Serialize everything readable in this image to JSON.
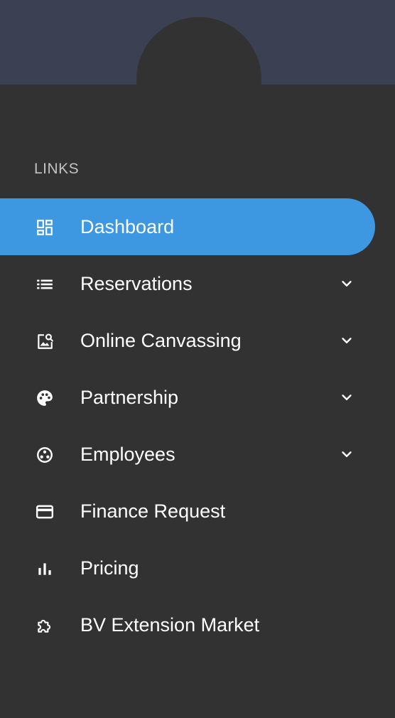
{
  "colors": {
    "header": "#3b4152",
    "background": "#323232",
    "active": "#3d98e1",
    "text": "#ffffff",
    "muted": "#c2c2c2"
  },
  "section": {
    "label": "LINKS"
  },
  "menu": {
    "items": [
      {
        "label": "Dashboard",
        "icon": "dashboard-icon",
        "active": true,
        "expandable": false
      },
      {
        "label": "Reservations",
        "icon": "list-icon",
        "active": false,
        "expandable": true
      },
      {
        "label": "Online Canvassing",
        "icon": "image-search-icon",
        "active": false,
        "expandable": true
      },
      {
        "label": "Partnership",
        "icon": "palette-icon",
        "active": false,
        "expandable": true
      },
      {
        "label": "Employees",
        "icon": "group-circle-icon",
        "active": false,
        "expandable": true
      },
      {
        "label": "Finance Request",
        "icon": "credit-card-icon",
        "active": false,
        "expandable": false
      },
      {
        "label": "Pricing",
        "icon": "bar-chart-icon",
        "active": false,
        "expandable": false
      },
      {
        "label": "BV Extension Market",
        "icon": "puzzle-icon",
        "active": false,
        "expandable": false
      }
    ]
  }
}
